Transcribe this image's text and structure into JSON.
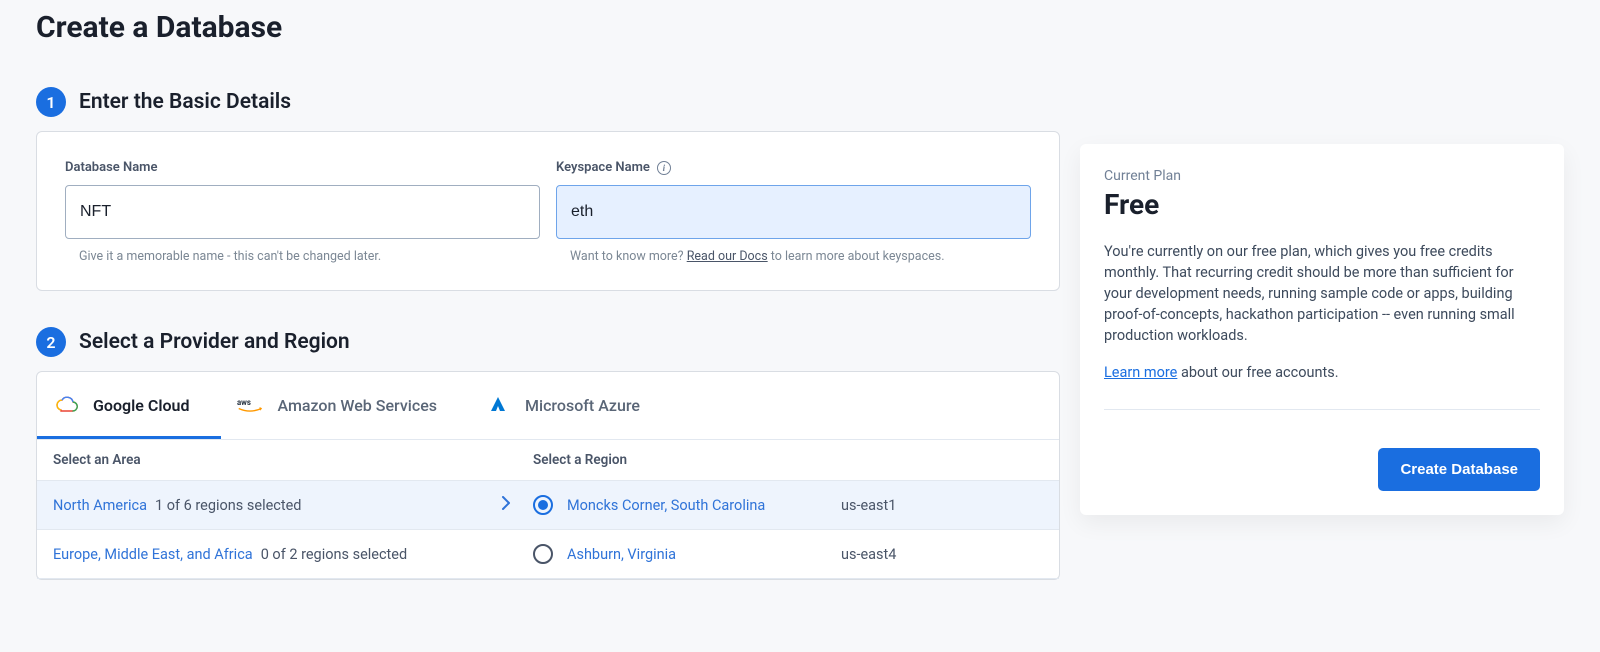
{
  "page_title": "Create a Database",
  "step1": {
    "num": "1",
    "title": "Enter the Basic Details",
    "db_name_label": "Database Name",
    "db_name_value": "NFT",
    "db_name_hint": "Give it a memorable name - this can't be changed later.",
    "ks_name_label": "Keyspace Name",
    "ks_name_value": "eth",
    "ks_hint_prefix": "Want to know more? ",
    "ks_hint_link": "Read our Docs",
    "ks_hint_suffix": " to learn more about keyspaces."
  },
  "step2": {
    "num": "2",
    "title": "Select a Provider and Region",
    "tabs": [
      {
        "label": "Google Cloud",
        "active": true
      },
      {
        "label": "Amazon Web Services",
        "active": false
      },
      {
        "label": "Microsoft Azure",
        "active": false
      }
    ],
    "area_header": "Select an Area",
    "region_header": "Select a Region",
    "rows": [
      {
        "area_name": "North America",
        "area_sub": "1 of 6 regions selected",
        "selected": true,
        "show_chevron": true,
        "region_name": "Moncks Corner, South Carolina",
        "region_code": "us-east1",
        "radio_checked": true
      },
      {
        "area_name": "Europe, Middle East, and Africa",
        "area_sub": "0 of 2 regions selected",
        "selected": false,
        "show_chevron": false,
        "region_name": "Ashburn, Virginia",
        "region_code": "us-east4",
        "radio_checked": false
      }
    ]
  },
  "plan": {
    "label": "Current Plan",
    "name": "Free",
    "desc": "You're currently on our free plan, which gives you free credits monthly. That recurring credit should be more than sufficient for your development needs, running sample code or apps, building proof-of-concepts, hackathon participation -- even running small production workloads.",
    "learn_link": "Learn more",
    "learn_suffix": " about our free accounts.",
    "button": "Create Database"
  }
}
